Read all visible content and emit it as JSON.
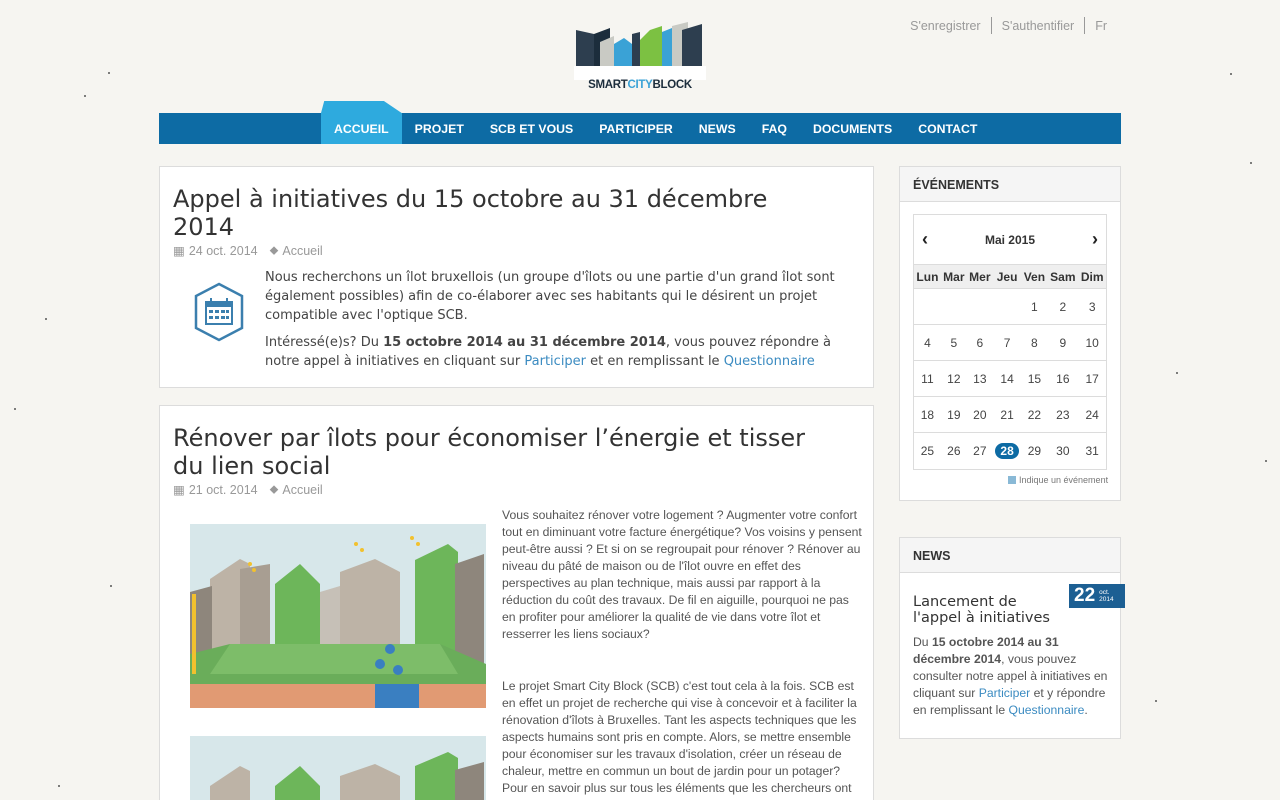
{
  "header": {
    "top_links": [
      "S'enregistrer",
      "S'authentifier",
      "Fr"
    ],
    "logo": {
      "part1": "SMART",
      "part2": "CITY",
      "part3": "BLOCK"
    }
  },
  "nav": {
    "items": [
      "ACCUEIL",
      "PROJET",
      "SCB ET VOUS",
      "PARTICIPER",
      "NEWS",
      "FAQ",
      "DOCUMENTS",
      "CONTACT"
    ],
    "active": "ACCUEIL"
  },
  "colors": {
    "nav": "#0d6ba4",
    "nav_active": "#2eaade",
    "link": "#3b8bc1",
    "date_badge": "#1c5f93"
  },
  "posts": [
    {
      "title": "Appel à initiatives du 15 octobre au 31 décembre 2014",
      "date": "24 oct. 2014",
      "category": "Accueil",
      "icon": "calendar-icon",
      "p1": "Nous recherchons un îlot bruxellois (un groupe d'îlots ou une partie d'un grand îlot sont également possibles) afin de co-élaborer avec ses habitants qui le désirent un projet compatible avec l'optique SCB.",
      "p2_start": "Intéressé(e)s? Du ",
      "p2_bold": "15 octobre 2014 au 31 décembre 2014",
      "p2_mid": ", vous pouvez répondre à notre appel à initiatives en cliquant sur ",
      "link1": "Participer",
      "p2_mid2": "  et en remplissant le ",
      "link2": "Questionnaire"
    },
    {
      "title": "Rénover par îlots pour économiser l’énergie et tisser du lien social",
      "date": "21 oct. 2014",
      "category": "Accueil",
      "p1": "Vous souhaitez rénover votre logement ? Augmenter votre confort tout en diminuant votre facture énergétique? Vos voisins y pensent peut-être aussi ? Et si on se regroupait pour rénover ? Rénover au niveau du pâté de maison ou de l'îlot ouvre en effet des perspectives au plan technique, mais aussi par rapport à la réduction du coût des travaux. De fil en aiguille, pourquoi ne pas en profiter pour améliorer la qualité de vie dans votre îlot et resserrer les liens sociaux?",
      "p2": "Le projet Smart City Block (SCB) c'est tout cela à la fois. SCB est en effet un projet de recherche qui vise à concevoir et à faciliter la rénovation d'îlots à Bruxelles. Tant les aspects techniques que les aspects humains sont pris en compte. Alors, se mettre ensemble pour économiser sur les travaux d'isolation, créer un réseau de chaleur, mettre en commun un bout de jardin pour un potager? Pour en savoir plus sur tous les éléments que les chercheurs ont"
    }
  ],
  "events": {
    "heading": "ÉVÉNEMENTS",
    "month": "Mai 2015",
    "days": [
      "Lun",
      "Mar",
      "Mer",
      "Jeu",
      "Ven",
      "Sam",
      "Dim"
    ],
    "weeks": [
      [
        "",
        "",
        "",
        "",
        "1",
        "2",
        "3"
      ],
      [
        "4",
        "5",
        "6",
        "7",
        "8",
        "9",
        "10"
      ],
      [
        "11",
        "12",
        "13",
        "14",
        "15",
        "16",
        "17"
      ],
      [
        "18",
        "19",
        "20",
        "21",
        "22",
        "23",
        "24"
      ],
      [
        "25",
        "26",
        "27",
        "28",
        "29",
        "30",
        "31"
      ]
    ],
    "today": "28",
    "legend": "Indique un événement"
  },
  "news": {
    "heading": "NEWS",
    "title": "Lancement de l'appel à initiatives",
    "day": "22",
    "month": "oct.",
    "year": "2014",
    "b1": "Du ",
    "bold": "15 octobre 2014 au 31 décembre 2014",
    "b2": ", vous pouvez consulter notre appel à initiatives en cliquant sur ",
    "link1": "Participer",
    "b3": "  et y répondre en remplissant le ",
    "link2": "Questionnaire",
    "b4": "."
  }
}
